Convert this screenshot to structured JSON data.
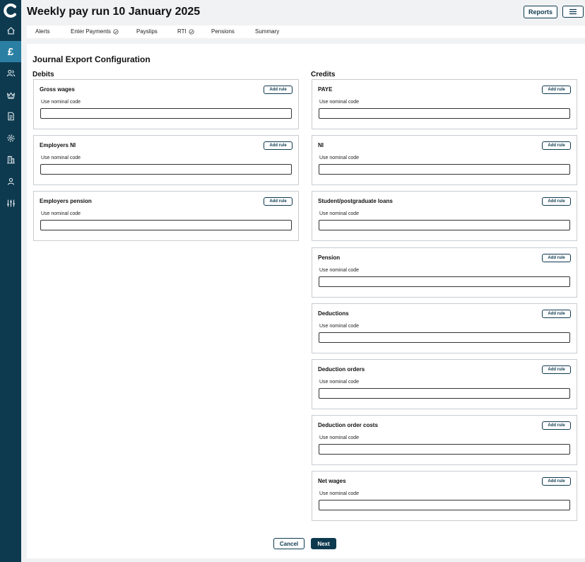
{
  "colors": {
    "brand": "#0e3a4f",
    "active": "#2b7fa3"
  },
  "sidebar": {
    "logo": "C",
    "items": [
      {
        "icon": "home-icon"
      },
      {
        "icon": "pound-icon",
        "label": "£",
        "active": true
      },
      {
        "icon": "people-icon"
      },
      {
        "icon": "crown-icon"
      },
      {
        "icon": "document-icon"
      },
      {
        "icon": "gear-icon"
      },
      {
        "icon": "building-icon"
      },
      {
        "icon": "person-icon"
      },
      {
        "icon": "sliders-icon"
      }
    ]
  },
  "header": {
    "title": "Weekly pay run 10 January 2025",
    "reports_label": "Reports",
    "menu_icon": "hamburger-icon"
  },
  "tabs": [
    {
      "label": "Alerts",
      "check": false
    },
    {
      "label": "Enter Payments",
      "check": true
    },
    {
      "label": "Payslips",
      "check": false
    },
    {
      "label": "RTI",
      "check": true
    },
    {
      "label": "Pensions",
      "check": false
    },
    {
      "label": "Summary",
      "check": false
    }
  ],
  "page": {
    "section_title": "Journal Export Configuration",
    "field_label": "Use nominal code",
    "add_rule_label": "Add rule",
    "debits": {
      "heading": "Debits",
      "items": [
        {
          "title": "Gross wages",
          "value": ""
        },
        {
          "title": "Employers NI",
          "value": ""
        },
        {
          "title": "Employers pension",
          "value": ""
        }
      ]
    },
    "credits": {
      "heading": "Credits",
      "items": [
        {
          "title": "PAYE",
          "value": ""
        },
        {
          "title": "NI",
          "value": ""
        },
        {
          "title": "Student/postgraduate loans",
          "value": ""
        },
        {
          "title": "Pension",
          "value": ""
        },
        {
          "title": "Deductions",
          "value": ""
        },
        {
          "title": "Deduction orders",
          "value": ""
        },
        {
          "title": "Deduction order costs",
          "value": ""
        },
        {
          "title": "Net wages",
          "value": ""
        }
      ]
    },
    "cancel_label": "Cancel",
    "next_label": "Next"
  }
}
